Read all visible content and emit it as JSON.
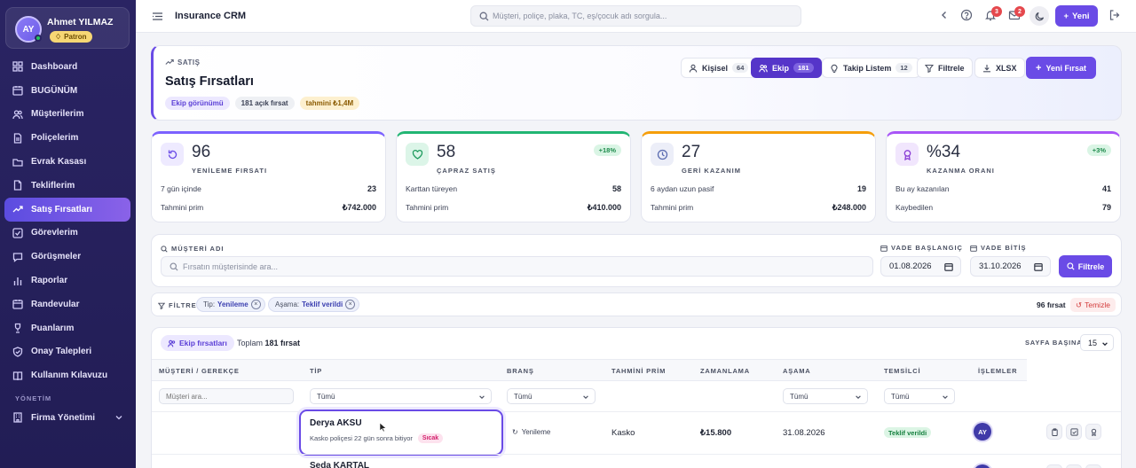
{
  "user": {
    "initials": "AY",
    "name": "Ahmet YILMAZ",
    "role": "Patron"
  },
  "sidebar": {
    "items": [
      {
        "label": "Dashboard",
        "icon": "grid-icon"
      },
      {
        "label": "BUGÜNÜM",
        "icon": "calendar-icon"
      },
      {
        "label": "Müşterilerim",
        "icon": "users-icon"
      },
      {
        "label": "Poliçelerim",
        "icon": "document-icon"
      },
      {
        "label": "Evrak Kasası",
        "icon": "folder-icon"
      },
      {
        "label": "Tekliflerim",
        "icon": "file-icon"
      },
      {
        "label": "Satış Fırsatları",
        "icon": "trend-up-icon",
        "active": true
      },
      {
        "label": "Görevlerim",
        "icon": "check-square-icon"
      },
      {
        "label": "Görüşmeler",
        "icon": "chat-icon"
      },
      {
        "label": "Raporlar",
        "icon": "bar-chart-icon"
      },
      {
        "label": "Randevular",
        "icon": "calendar-icon"
      },
      {
        "label": "Puanlarım",
        "icon": "trophy-icon"
      },
      {
        "label": "Onay Talepleri",
        "icon": "shield-check-icon"
      },
      {
        "label": "Kullanım Kılavuzu",
        "icon": "book-icon"
      }
    ],
    "section_label": "YÖNETİM",
    "firma_label": "Firma Yönetimi"
  },
  "topbar": {
    "title": "Insurance CRM",
    "search_placeholder": "Müşteri, poliçe, plaka, TC, eş/çocuk adı sorgula...",
    "notif_count": "3",
    "mail_count": "2",
    "new_label": "Yeni"
  },
  "header": {
    "kicker": "SATIŞ",
    "title": "Satış Fırsatları",
    "chip_view": "Ekip görünümü",
    "chip_open": "181 açık fırsat",
    "chip_estimate": "tahmini ₺1,4M",
    "btn_personal": "Kişisel",
    "btn_personal_count": "64",
    "btn_team": "Ekip",
    "btn_team_count": "181",
    "btn_follow": "Takip Listem",
    "btn_follow_count": "12",
    "btn_filter": "Filtrele",
    "btn_xlsx": "XLSX",
    "btn_new": "Yeni Fırsat"
  },
  "stats": [
    {
      "value": "96",
      "label": "YENİLEME FIRSATI",
      "row1_label": "7 gün içinde",
      "row1_value": "23",
      "row2_label": "Tahmini prim",
      "row2_value": "₺742.000",
      "color": "#7b61ff"
    },
    {
      "value": "58",
      "label": "ÇAPRAZ SATIŞ",
      "delta": "+18%",
      "row1_label": "Karttan türeyen",
      "row1_value": "58",
      "row2_label": "Tahmini prim",
      "row2_value": "₺410.000",
      "color": "#22b573"
    },
    {
      "value": "27",
      "label": "GERİ KAZANIM",
      "row1_label": "6 aydan uzun pasif",
      "row1_value": "19",
      "row2_label": "Tahmini prim",
      "row2_value": "₺248.000",
      "color": "#f59e0b"
    },
    {
      "value": "%34",
      "label": "KAZANMA ORANI",
      "delta": "+3%",
      "row1_label": "Bu ay kazanılan",
      "row1_value": "41",
      "row2_label": "Kaybedilen",
      "row2_value": "79",
      "color": "#a855f7"
    }
  ],
  "filters": {
    "customer_label": "MÜŞTERİ ADI",
    "customer_placeholder": "Fırsatın müşterisinde ara...",
    "start_label": "VADE BAŞLANGIÇ",
    "start_value": "01.08.2026",
    "end_label": "VADE BİTİŞ",
    "end_value": "31.10.2026",
    "apply": "Filtrele"
  },
  "active_filters": {
    "label": "FİLTRE",
    "chips": [
      {
        "key": "Tip:",
        "value": "Yenileme"
      },
      {
        "key": "Aşama:",
        "value": "Teklif verildi"
      }
    ],
    "count": "96 fırsat",
    "clear": "Temizle"
  },
  "table": {
    "tab": "Ekip fırsatları",
    "total_prefix": "Toplam",
    "total_value": "181 fırsat",
    "page_size_label": "SAYFA BAŞINA",
    "page_size": "15",
    "columns": [
      "MÜŞTERİ / GEREKÇE",
      "TİP",
      "BRANŞ",
      "TAHMİNİ PRİM",
      "ZAMANLAMA",
      "AŞAMA",
      "TEMSİLCİ",
      "İŞLEMLER"
    ],
    "filter_placeholder": "Müşteri ara...",
    "filter_all": "Tümü",
    "rows": [
      {
        "customer": "Derya AKSU",
        "reason": "Kasko poliçesi 22 gün sonra bitiyor",
        "tag": "Sıcak",
        "type": "Yenileme",
        "branch": "Kasko",
        "premium": "₺15.800",
        "timing": "31.08.2026",
        "stage": "Teklif verildi",
        "rep": "AY"
      },
      {
        "customer": "Seda KARTAL"
      }
    ]
  }
}
